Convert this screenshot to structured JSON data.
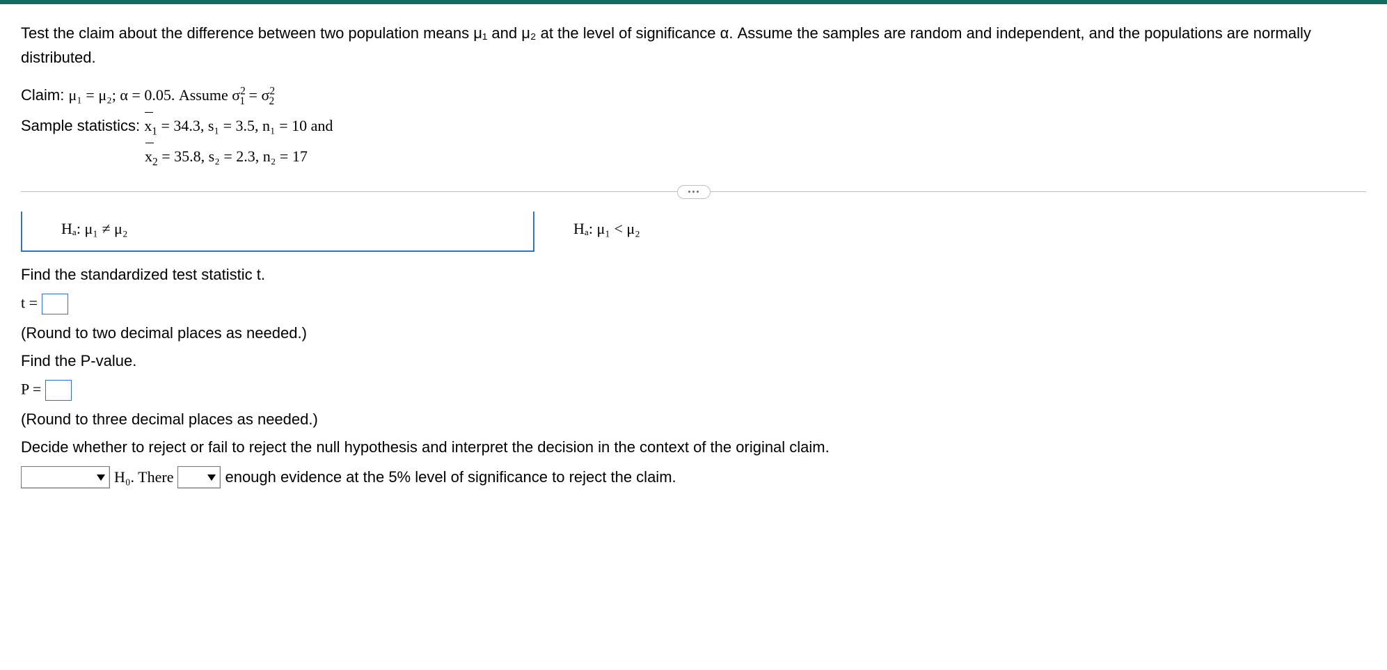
{
  "problem": {
    "intro": "Test the claim about the difference between two population means μ₁ and μ₂ at the level of significance α. Assume the samples are random and independent, and the populations are normally distributed.",
    "claim_label": "Claim: ",
    "claim_expr": "μ₁ = μ₂; α = 0.05. Assume ",
    "variance_expr": "σ",
    "variance_tail": " = σ",
    "sample_stats_label": "Sample statistics:  ",
    "stats_line1": " = 34.3, s₁ = 3.5, n₁ = 10 and",
    "stats_line2": " = 35.8, s₂ = 2.3, n₂ = 17",
    "x1_sym": "x₁",
    "x2_sym": "x₂"
  },
  "options": {
    "left": "Hₐ: μ₁ ≠ μ₂",
    "right": "Hₐ: μ₁ < μ₂"
  },
  "questions": {
    "find_t": "Find the standardized test statistic t.",
    "t_label": "t = ",
    "t_round": "(Round to two decimal places as needed.)",
    "find_p": "Find the P-value.",
    "p_label": "P = ",
    "p_round": "(Round to three decimal places as needed.)",
    "decide": "Decide whether to reject or fail to reject the null hypothesis and interpret the decision in the context of the original claim."
  },
  "conclusion": {
    "h0_text": " H₀. There ",
    "tail": " enough evidence at the 5% level of significance to reject the claim."
  },
  "inputs": {
    "t_value": "",
    "p_value": "",
    "decision": "",
    "evidence": ""
  }
}
